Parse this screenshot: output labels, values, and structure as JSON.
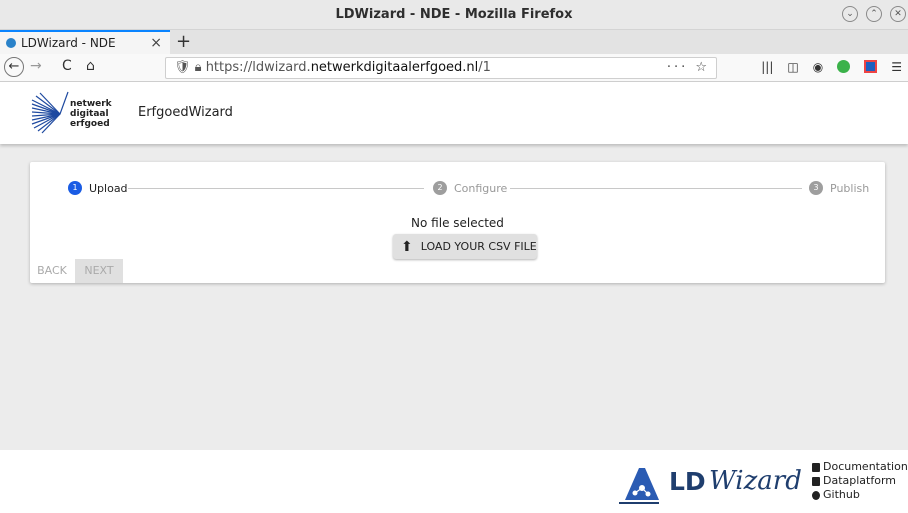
{
  "window": {
    "title": "LDWizard - NDE - Mozilla Firefox",
    "controls": [
      "⌄",
      "⌃",
      "✕"
    ]
  },
  "tabs": [
    {
      "label": "LDWizard - NDE",
      "close": "×"
    }
  ],
  "newtab": "+",
  "nav": {
    "back": "←",
    "forward": "→",
    "reload": "C",
    "home": "⌂"
  },
  "url": {
    "prefix": "https://ldwizard.",
    "domain": "netwerkdigitaalerfgoed.nl",
    "suffix": "/1",
    "page_actions": "··· ☆"
  },
  "app": {
    "logo_lines": [
      "netwerk",
      "digitaal",
      "erfgoed"
    ],
    "name": "ErfgoedWizard"
  },
  "steps": [
    {
      "num": "1",
      "label": "Upload"
    },
    {
      "num": "2",
      "label": "Configure"
    },
    {
      "num": "3",
      "label": "Publish"
    }
  ],
  "upload": {
    "status": "No file selected",
    "button": "LOAD YOUR CSV FILE"
  },
  "buttons": {
    "back": "BACK",
    "next": "NEXT"
  },
  "footer": {
    "logo_ld": "LD",
    "logo_wizard": "Wizard",
    "links": [
      "Documentation",
      "Dataplatform",
      "Github"
    ]
  },
  "colors": {
    "accent": "#1a5ce4",
    "brand": "#1f3e6e"
  }
}
